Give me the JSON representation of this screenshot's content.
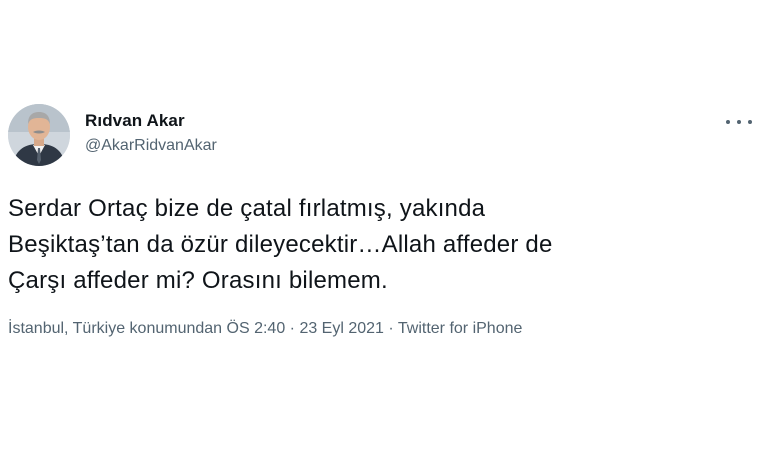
{
  "author": {
    "name": "Rıdvan Akar",
    "handle": "@AkarRidvanAkar",
    "avatar_icon": "user-avatar-photo"
  },
  "tweet": {
    "lines": [
      "Serdar Ortaç bize de çatal fırlatmış, yakında",
      "Beşiktaş’tan da özür dileyecektir…Allah affeder de",
      "Çarşı affeder mi? Orasını bilemem."
    ]
  },
  "meta": {
    "location": "İstanbul, Türkiye konumundan",
    "time": "ÖS 2:40",
    "separator": " · ",
    "date": "23 Eyl 2021",
    "source": "Twitter for iPhone"
  },
  "icons": {
    "more": "more-options-icon"
  },
  "colors": {
    "primary_text": "#0f1419",
    "secondary_text": "#536471"
  }
}
